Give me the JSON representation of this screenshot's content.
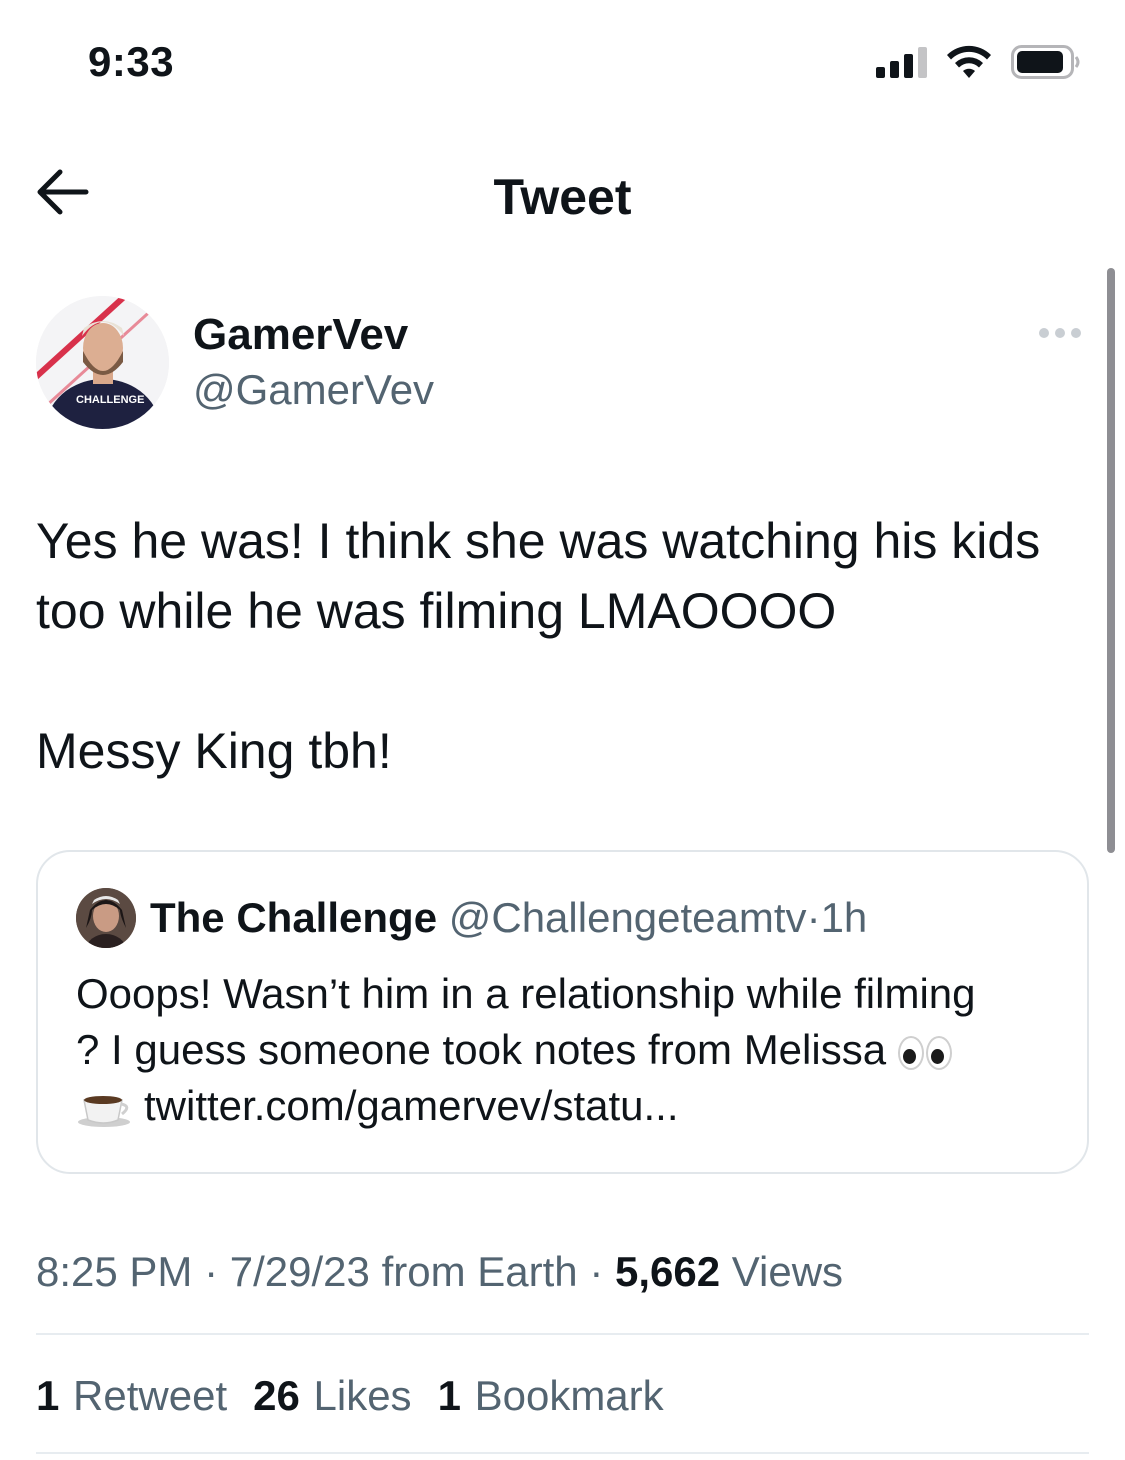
{
  "status_bar": {
    "time": "9:33"
  },
  "header": {
    "title": "Tweet"
  },
  "author": {
    "name": "GamerVev",
    "handle": "@GamerVev",
    "avatar_shirt_text": "CHALLENGE"
  },
  "tweet": {
    "text": "Yes he was! I think she was watching his kids too while he was filming LMAOOOO\n\nMessy King tbh!"
  },
  "quote": {
    "name": "The Challenge",
    "handle": "@Challengeteamtv",
    "separator": "·",
    "time": "1h",
    "text_line1": "Ooops! Wasn’t him in a relationship while filming",
    "text_line2": "? I guess someone took notes from Melissa",
    "link": "twitter.com/gamervev/statu..."
  },
  "meta": {
    "time": "8:25 PM",
    "sep1": "·",
    "date": "7/29/23",
    "source": "from Earth",
    "sep2": "·",
    "views_count": "5,662",
    "views_label": "Views"
  },
  "stats": {
    "retweets_count": "1",
    "retweets_label": "Retweet",
    "likes_count": "26",
    "likes_label": "Likes",
    "bookmarks_count": "1",
    "bookmarks_label": "Bookmark"
  },
  "icons": [
    "back-arrow-icon",
    "more-icon",
    "signal-icon",
    "wifi-icon",
    "battery-icon",
    "eyes-emoji-icon",
    "coffee-emoji-icon"
  ],
  "colors": {
    "text": "#0f1419",
    "secondary": "#536471",
    "border": "#e1e6ea"
  }
}
